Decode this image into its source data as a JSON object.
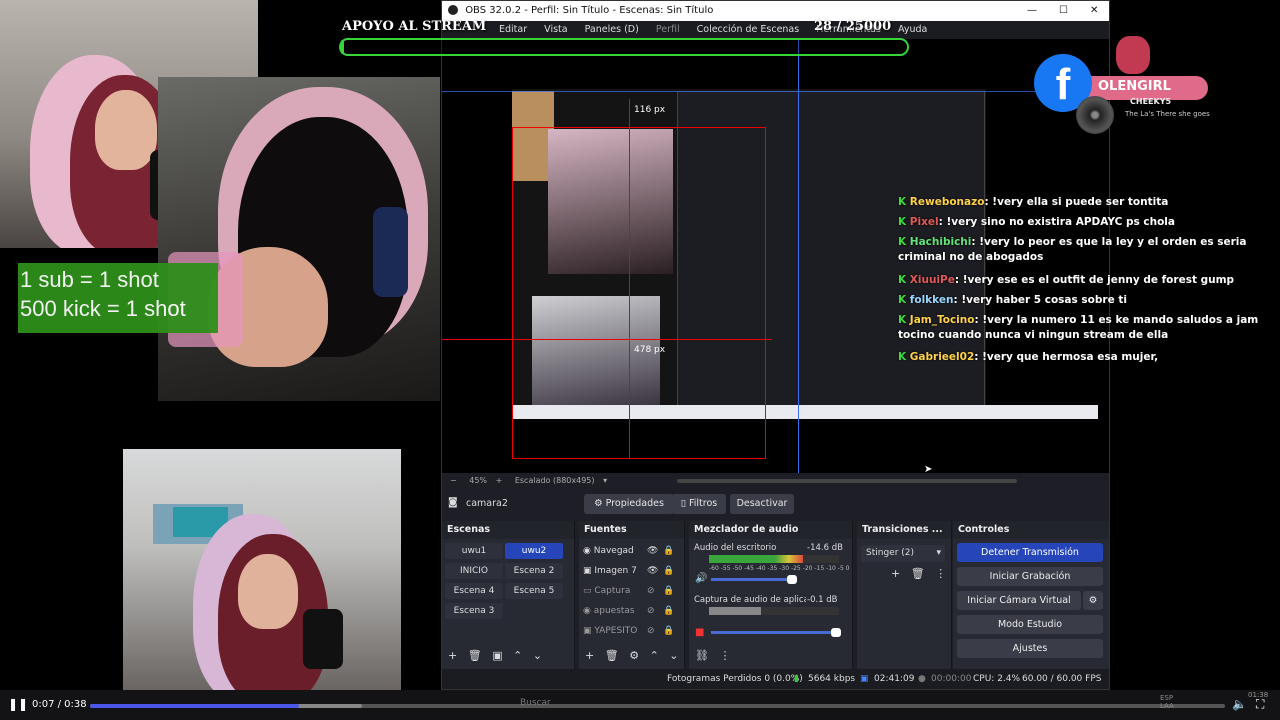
{
  "overlay": {
    "goal_title": "APOYO AL STREAM",
    "goal_count": "28 / 25000",
    "rules_line1": "1 sub = 1 shot",
    "rules_line2": "500 kick = 1 shot",
    "brand_name": "OLENGIRL",
    "brand_icon": "facebook-icon"
  },
  "obs": {
    "title": "OBS 32.0.2 - Perfil: Sin Título - Escenas: Sin Título",
    "menu": [
      "Editar",
      "Vista",
      "Paneles (D)",
      "Perfil",
      "Colección de Escenas",
      "Herramientas",
      "Ayuda"
    ],
    "zoom": "45%",
    "scaled": "Escalado (880x495)",
    "current_source": "camara2",
    "properties_btn": "Propiedades",
    "filters_btn": "Filtros",
    "deactivate_btn": "Desactivar",
    "measure_top": "116 px",
    "measure_side": "478 px",
    "scenes": {
      "title": "Escenas",
      "items": [
        "uwu1",
        "uwu2",
        "INICIO",
        "Escena 2",
        "Escena 4",
        "Escena 5",
        "Escena 3"
      ],
      "active": "uwu2"
    },
    "sources": {
      "title": "Fuentes",
      "items": [
        "Navegad",
        "Imagen 7",
        "Captura",
        "apuestas",
        "YAPESITO"
      ]
    },
    "mixer": {
      "title": "Mezclador de audio",
      "ch1_name": "Audio del escritorio",
      "ch1_db": "-14.6 dB",
      "ch2_name": "Captura de audio de aplicación (BE",
      "ch2_db": "-0.1 dB",
      "scale": "-60 -55 -50 -45 -40 -35 -30 -25 -20 -15 -10 -5 0",
      "ch1_level": 0.72,
      "ch2_level": 0.4
    },
    "transitions": {
      "title": "Transiciones ...",
      "selected": "Stinger (2)"
    },
    "controls": {
      "title": "Controles",
      "stop_stream": "Detener Transmisión",
      "start_recording": "Iniciar Grabación",
      "virtual_cam": "Iniciar Cámara Virtual",
      "studio_mode": "Modo Estudio",
      "settings": "Ajustes"
    },
    "status": {
      "dropped": "Fotogramas Perdidos 0 (0.0%)",
      "bitrate": "5664 kbps",
      "live_time": "02:41:09",
      "rec_time": "00:00:00",
      "cpu": "CPU: 2.4%",
      "fps": "60.00 / 60.00 FPS"
    }
  },
  "chat": [
    {
      "user": "Rewebonazo",
      "msg": ": !very ella si puede ser tontita"
    },
    {
      "user": "Pixel",
      "msg": ": !very sino no existira APDAYC ps chola"
    },
    {
      "user": "Hachibichi",
      "msg": ": !very lo peor es que la ley y el orden es seria criminal no de abogados"
    },
    {
      "user": "XiuuiPe",
      "msg": ": !very ese es el outfit de jenny de forest gump"
    },
    {
      "user": "folkken",
      "msg": ": !very haber 5 cosas sobre ti"
    },
    {
      "user": "Jam_Tocino",
      "msg": ": !very la numero 11 es ke mando saludos a jam tocino cuando nunca vi ningun stream de ella"
    },
    {
      "user": "Gabrieel02",
      "msg": ": !very que hermosa esa mujer,"
    }
  ],
  "now_playing": {
    "title": "CHEEKY5",
    "artist": "The La's  There she goes"
  },
  "player": {
    "time": "0:07 / 0:38",
    "progress": 0.184,
    "buffered": 0.24,
    "search_placeholder": "Buscar",
    "lang": "ESP LAA",
    "clock": "01:38"
  }
}
